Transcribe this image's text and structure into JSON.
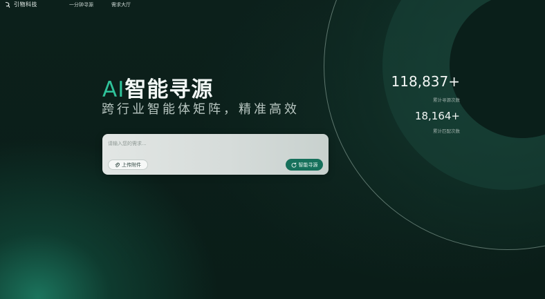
{
  "nav": {
    "logo_text": "引物科技",
    "links": [
      {
        "label": "一分钟寻源"
      },
      {
        "label": "需求大厅"
      }
    ]
  },
  "hero": {
    "title_ai": "AI",
    "title_rest": "智能寻源",
    "subtitle": "跨行业智能体矩阵，精准高效"
  },
  "search": {
    "placeholder": "请输入您的需求...",
    "value": "",
    "upload_label": "上传附件",
    "submit_label": "智能寻源",
    "upload_icon": "paperclip-icon",
    "submit_icon": "refresh-icon"
  },
  "stats": [
    {
      "value": "118,837+",
      "label": "累计寻源次数"
    },
    {
      "value": "18,164+",
      "label": "累计匹配次数"
    }
  ],
  "colors": {
    "background": "#0b1f1a",
    "accent": "#2fc29a",
    "button": "#16705b"
  }
}
